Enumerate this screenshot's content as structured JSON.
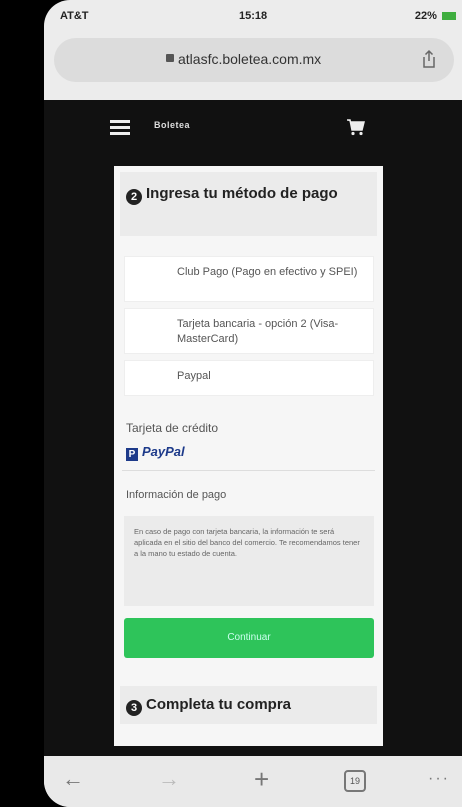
{
  "status": {
    "carrier": "AT&T",
    "time": "15:18",
    "battery": "22%"
  },
  "browser": {
    "url": "atlasfc.boletea.com.mx",
    "tab_count": "19"
  },
  "site": {
    "logo_text": "Boletea"
  },
  "step2": {
    "number": "2",
    "title": "Ingresa tu método de pago",
    "options": [
      {
        "label": "Club Pago (Pago en efectivo y SPEI)"
      },
      {
        "label": "Tarjeta bancaria - opción 2 (Visa-MasterCard)"
      },
      {
        "label": "Paypal"
      }
    ],
    "credit_label": "Tarjeta de crédito",
    "paypal_logo": "PayPal",
    "info_title": "Información de pago",
    "info_text": "En caso de pago con tarjeta bancaria, la información te será aplicada en el sitio del banco del comercio. Te recomendamos tener a la mano tu estado de cuenta.",
    "continue_label": "Continuar",
    "button_color": "#2ec45a"
  },
  "step3": {
    "number": "3",
    "title": "Completa tu compra"
  },
  "toolbar": {
    "back": "←",
    "forward": "→",
    "new_tab": "+",
    "more": "···"
  }
}
